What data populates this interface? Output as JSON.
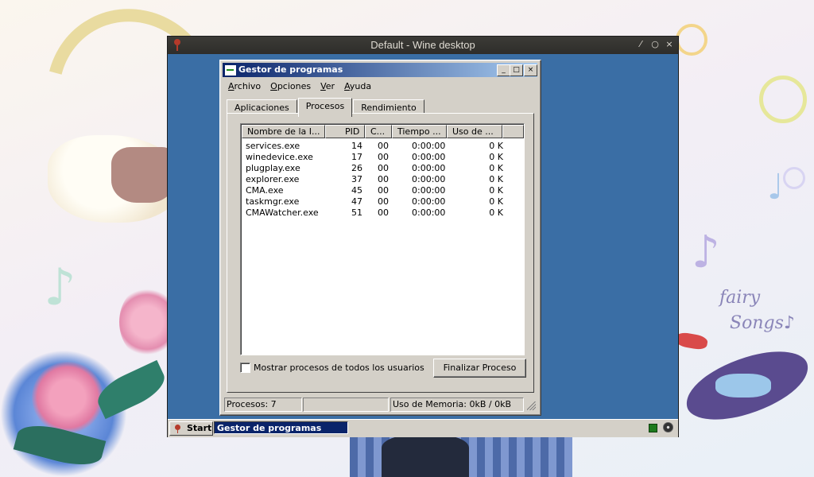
{
  "wine_window": {
    "title": "Default - Wine desktop",
    "controls": [
      "⁄",
      "○",
      "×"
    ]
  },
  "task_manager": {
    "title": "Gestor de programas",
    "title_buttons": [
      "_",
      "□",
      "×"
    ],
    "menu": [
      {
        "label": "Archivo",
        "mnemonic": "A",
        "rest": "rchivo"
      },
      {
        "label": "Opciones",
        "mnemonic": "O",
        "rest": "pciones"
      },
      {
        "label": "Ver",
        "mnemonic": "V",
        "rest": "er"
      },
      {
        "label": "Ayuda",
        "mnemonic": "A",
        "rest": "yuda"
      }
    ],
    "tabs": [
      "Aplicaciones",
      "Procesos",
      "Rendimiento"
    ],
    "active_tab": "Procesos",
    "columns": [
      "Nombre de la I...",
      "PID",
      "C...",
      "Tiempo ...",
      "Uso de ..."
    ],
    "processes": [
      {
        "name": "services.exe",
        "pid": "14",
        "cpu": "00",
        "time": "0:00:00",
        "mem": "0 K"
      },
      {
        "name": "winedevice.exe",
        "pid": "17",
        "cpu": "00",
        "time": "0:00:00",
        "mem": "0 K"
      },
      {
        "name": "plugplay.exe",
        "pid": "26",
        "cpu": "00",
        "time": "0:00:00",
        "mem": "0 K"
      },
      {
        "name": "explorer.exe",
        "pid": "37",
        "cpu": "00",
        "time": "0:00:00",
        "mem": "0 K"
      },
      {
        "name": "CMA.exe",
        "pid": "45",
        "cpu": "00",
        "time": "0:00:00",
        "mem": "0 K"
      },
      {
        "name": "taskmgr.exe",
        "pid": "47",
        "cpu": "00",
        "time": "0:00:00",
        "mem": "0 K"
      },
      {
        "name": "CMAWatcher.exe",
        "pid": "51",
        "cpu": "00",
        "time": "0:00:00",
        "mem": "0 K"
      }
    ],
    "show_all_label": "Mostrar procesos de todos los usuarios",
    "show_all_checked": false,
    "end_process_label": "Finalizar Proceso",
    "status": {
      "processes": "Procesos: 7",
      "cpu": "",
      "memory": "Uso de Memoria: 0kB / 0kB"
    }
  },
  "taskbar": {
    "start_label": "Start",
    "task_label": "Gestor de programas"
  },
  "wallpaper": {
    "text_line1": "fairy",
    "text_line2": "Songs♪",
    "notes": [
      "♪",
      "♪",
      "♩"
    ]
  },
  "colors": {
    "desktop_bg": "#3a6ea5",
    "title_active": "#0a246a",
    "face": "#d4d0c8"
  }
}
